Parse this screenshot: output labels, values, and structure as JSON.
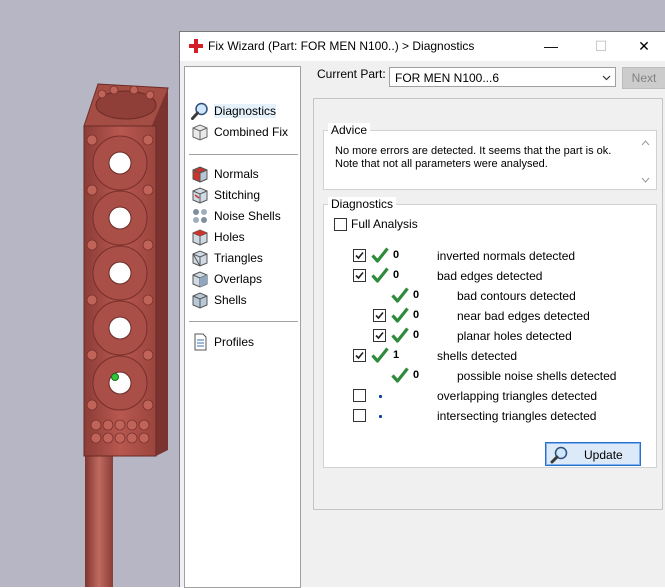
{
  "window": {
    "title": "Fix Wizard (Part: FOR MEN N100..) > Diagnostics",
    "controls": {
      "minimize": "—",
      "maximize": "☐",
      "close": "✕"
    }
  },
  "sidebar": {
    "group1": [
      {
        "label": "Diagnostics",
        "icon": "magnifier-icon",
        "selected": true
      },
      {
        "label": "Combined Fix",
        "icon": "combined-fix-icon"
      }
    ],
    "group2": [
      {
        "label": "Normals",
        "icon": "normals-cube-icon"
      },
      {
        "label": "Stitching",
        "icon": "stitching-cube-icon"
      },
      {
        "label": "Noise Shells",
        "icon": "noise-shells-icon"
      },
      {
        "label": "Holes",
        "icon": "holes-cube-icon"
      },
      {
        "label": "Triangles",
        "icon": "triangles-cube-icon"
      },
      {
        "label": "Overlaps",
        "icon": "overlaps-cube-icon"
      },
      {
        "label": "Shells",
        "icon": "shells-cube-icon"
      }
    ],
    "group3": [
      {
        "label": "Profiles",
        "icon": "document-icon"
      }
    ]
  },
  "header": {
    "current_part_label": "Current Part:",
    "current_part_value": "FOR MEN N100...6",
    "next_label": "Next"
  },
  "advice": {
    "title": "Advice",
    "text": "No more errors are detected. It seems that the part is ok. Note that not all parameters were analysed."
  },
  "diagnostics": {
    "title": "Diagnostics",
    "full_analysis_label": "Full Analysis",
    "full_analysis_checked": false,
    "rows": [
      {
        "indent": 0,
        "checkbox": true,
        "checked": true,
        "status": "ok",
        "count": "0",
        "label": "inverted normals detected"
      },
      {
        "indent": 0,
        "checkbox": true,
        "checked": true,
        "status": "ok",
        "count": "0",
        "label": "bad edges detected"
      },
      {
        "indent": 1,
        "checkbox": false,
        "checked": false,
        "status": "ok",
        "count": "0",
        "label": "bad contours detected"
      },
      {
        "indent": 1,
        "checkbox": true,
        "checked": true,
        "status": "ok",
        "count": "0",
        "label": "near bad edges detected"
      },
      {
        "indent": 1,
        "checkbox": true,
        "checked": true,
        "status": "ok",
        "count": "0",
        "label": "planar holes detected"
      },
      {
        "indent": 0,
        "checkbox": true,
        "checked": true,
        "status": "ok",
        "count": "1",
        "label": "shells detected"
      },
      {
        "indent": 1,
        "checkbox": false,
        "checked": false,
        "status": "ok",
        "count": "0",
        "label": "possible noise shells detected"
      },
      {
        "indent": 0,
        "checkbox": true,
        "checked": false,
        "status": "unknown",
        "count": "",
        "label": "overlapping triangles detected"
      },
      {
        "indent": 0,
        "checkbox": true,
        "checked": false,
        "status": "unknown",
        "count": "",
        "label": "intersecting triangles detected"
      }
    ],
    "update_label": "Update"
  },
  "colors": {
    "check_green": "#2e8b3c",
    "model_red": "#b5574f",
    "viewport_bg": "#b6b6c4"
  }
}
